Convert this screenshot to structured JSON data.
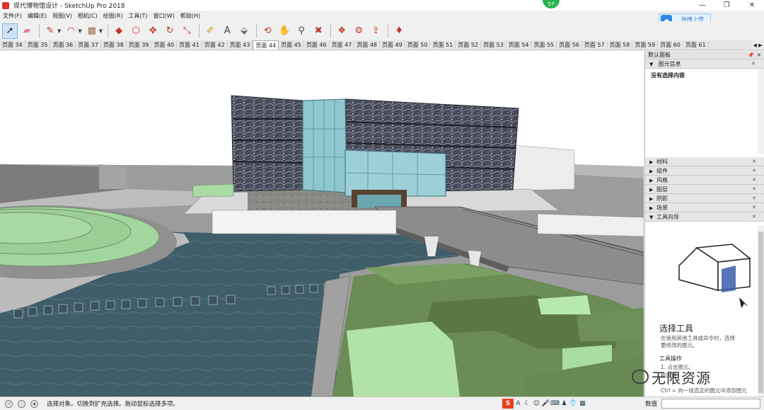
{
  "window": {
    "title": "现代博物馆设计 - SketchUp Pro 2018",
    "minimize_glyph": "—",
    "restore_glyph": "❐",
    "close_glyph": "✕"
  },
  "notification_badge": "57",
  "upload_button": {
    "label": "拖拽上传",
    "icon": "cloud-icon"
  },
  "menu": [
    "文件(F)",
    "编辑(E)",
    "视图(V)",
    "相机(C)",
    "绘图(R)",
    "工具(T)",
    "窗口(W)",
    "帮助(H)"
  ],
  "toolbar": [
    {
      "name": "select-tool",
      "glyph": "➚",
      "color": "#222222",
      "active": true
    },
    {
      "name": "eraser-tool",
      "glyph": "▰",
      "color": "#e07a9a"
    },
    {
      "name": "line-tool",
      "glyph": "✎",
      "color": "#c0392b",
      "dropdown": true
    },
    {
      "name": "arc-tool",
      "glyph": "◠",
      "color": "#c0392b",
      "dropdown": true
    },
    {
      "name": "shape-tool",
      "glyph": "▩",
      "color": "#a07050",
      "dropdown": true
    },
    {
      "name": "push-pull-tool",
      "glyph": "◆",
      "color": "#c0392b"
    },
    {
      "name": "offset-tool",
      "glyph": "⬡",
      "color": "#c0392b"
    },
    {
      "name": "move-tool",
      "glyph": "✥",
      "color": "#c0392b"
    },
    {
      "name": "rotate-tool",
      "glyph": "↻",
      "color": "#c0392b"
    },
    {
      "name": "scale-tool",
      "glyph": "⤡",
      "color": "#c0392b"
    },
    {
      "name": "tape-measure-tool",
      "glyph": "✐",
      "color": "#c9a400"
    },
    {
      "name": "text-tool",
      "glyph": "A",
      "color": "#444444"
    },
    {
      "name": "paint-bucket-tool",
      "glyph": "⬙",
      "color": "#666666"
    },
    {
      "name": "orbit-tool",
      "glyph": "⟲",
      "color": "#c0392b"
    },
    {
      "name": "pan-tool",
      "glyph": "✋",
      "color": "#d9a64a"
    },
    {
      "name": "zoom-tool",
      "glyph": "⚲",
      "color": "#444444"
    },
    {
      "name": "zoom-extents-tool",
      "glyph": "✖",
      "color": "#c0392b"
    },
    {
      "name": "warehouse-tool",
      "glyph": "❖",
      "color": "#c0392b"
    },
    {
      "name": "extension-warehouse-tool",
      "glyph": "⚙",
      "color": "#c0392b"
    },
    {
      "name": "share-model-tool",
      "glyph": "⇪",
      "color": "#c0392b"
    },
    {
      "name": "ruby-tool",
      "glyph": "♦",
      "color": "#c0392b"
    }
  ],
  "scene_tabs": [
    "页面 34",
    "页面 35",
    "页面 36",
    "页面 37",
    "页面 38",
    "页面 39",
    "页面 40",
    "页面 41",
    "页面 42",
    "页面 43",
    "页面 44",
    "页面 45",
    "页面 46",
    "页面 47",
    "页面 48",
    "页面 49",
    "页面 50",
    "页面 51",
    "页面 52",
    "页面 53",
    "页面 54",
    "页面 55",
    "页面 56",
    "页面 57",
    "页面 58",
    "页面 59",
    "页面 60",
    "页面 61"
  ],
  "active_scene": "页面 44",
  "scene_tab_arrows": "◀ ▶",
  "tray": {
    "title": "默认面板",
    "entity_info": {
      "label": "图元信息",
      "content": "没有选择内容"
    },
    "panels": [
      "材料",
      "组件",
      "风格",
      "图层",
      "阴影",
      "场景",
      "工具向导"
    ],
    "instructor": {
      "title": "选择工具",
      "description": "在使用其他工具或命令时，选择要修改的图元。",
      "operations_title": "工具操作",
      "op1": "1. 点击图元。",
      "op2": "修改键：",
      "op3": "Ctrl = 向一组选定的图元中添加图元"
    }
  },
  "watermark": "无限资源",
  "status": {
    "text": "选择对象。切换到扩充选择。拖动鼠标选择多项。",
    "measurement_label": "数值",
    "measurement_value": "",
    "ime_logo": "S",
    "ime_icons": [
      "A",
      "☾",
      "☺",
      "🎤",
      "⌨",
      "♟",
      "👕",
      "▦"
    ]
  },
  "colors": {
    "facade_dark": "#3e4150",
    "glass": "#86c1cc",
    "water": "#3d5d68",
    "lawn": "#9fd49a",
    "green_block": "#66854f",
    "plaza": "#b9b9b9"
  }
}
